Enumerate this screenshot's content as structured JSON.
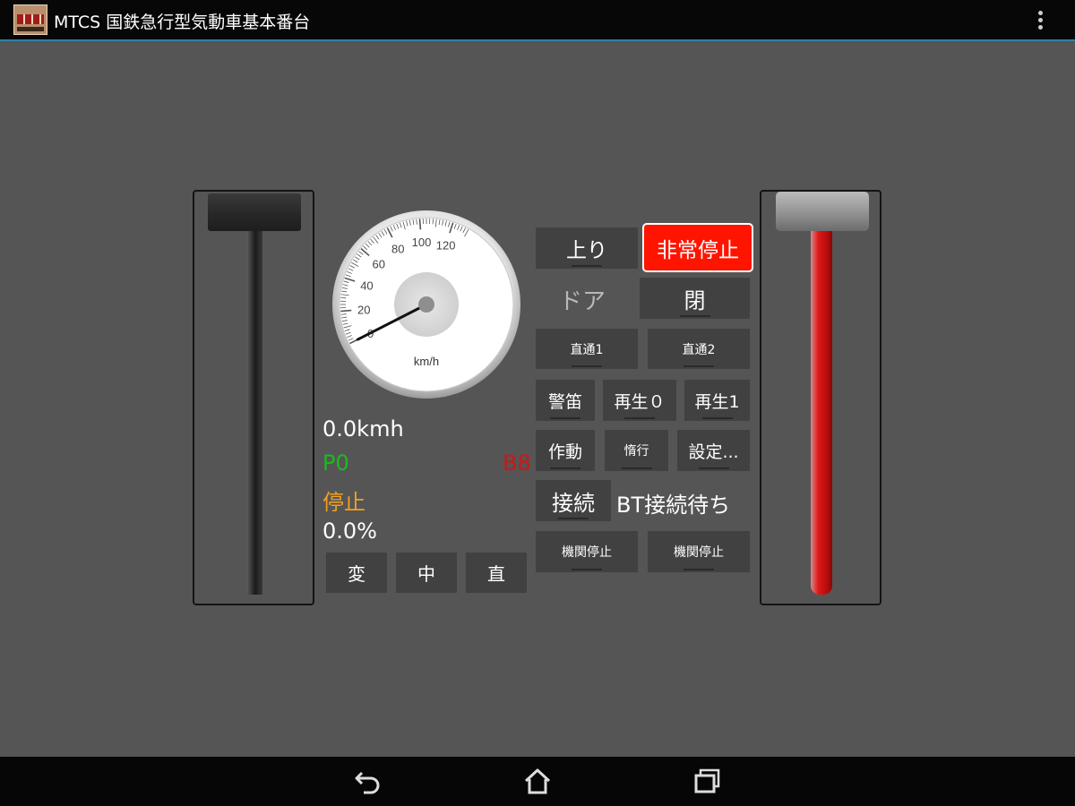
{
  "app": {
    "title": "MTCS 国鉄急行型気動車基本番台"
  },
  "speedometer": {
    "unit": "km/h",
    "scale_labels": [
      "0",
      "20",
      "40",
      "60",
      "80",
      "100",
      "120"
    ],
    "speed_kmh": 0
  },
  "readouts": {
    "speed": "0.0kmh",
    "power_notch": "P0",
    "brake_notch": "B8",
    "status": "停止",
    "percent": "0.0%"
  },
  "buttons": {
    "direction": "上り",
    "emergency": "非常停止",
    "door_label": "ドア",
    "door": "閉",
    "direct1": "直通1",
    "direct2": "直通2",
    "whistle": "警笛",
    "play0": "再生０",
    "play1": "再生1",
    "action": "作動",
    "coast": "惰行",
    "settings": "設定...",
    "connect": "接続",
    "bt_status": "BT接続待ち",
    "engine_stop_1": "機関停止",
    "engine_stop_2": "機関停止",
    "gear_change": "変",
    "gear_neutral": "中",
    "gear_direct": "直"
  },
  "colors": {
    "background": "#555555",
    "button": "#414141",
    "emergency": "#ff1400",
    "power_notch": "#1fb81f",
    "brake_notch": "#c91818",
    "status": "#f0a020",
    "accent_line": "#2d7fa8"
  },
  "icons": [
    "app-icon",
    "overflow-menu-icon",
    "back-icon",
    "home-icon",
    "recent-apps-icon"
  ]
}
